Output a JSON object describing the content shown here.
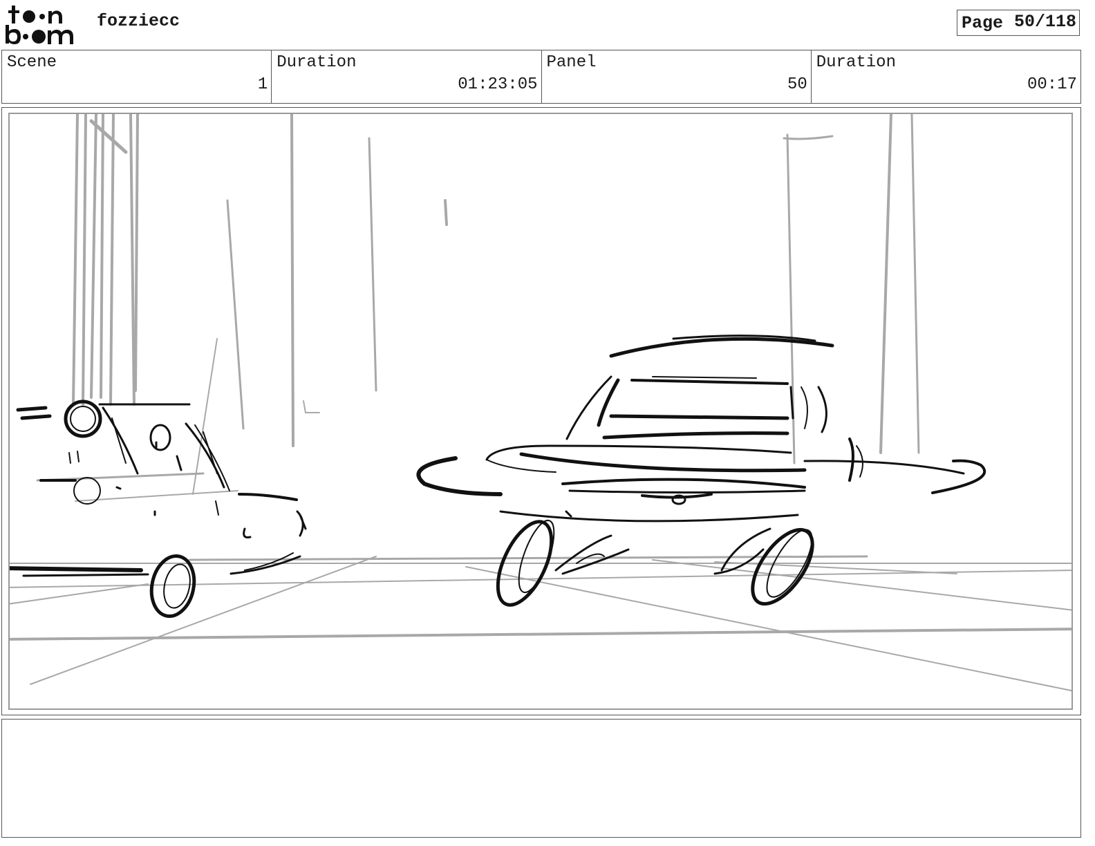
{
  "header": {
    "brand": "toon boom",
    "project_name": "fozziecc",
    "page_label": "Page",
    "page_value": "50/118"
  },
  "info": {
    "scene_label": "Scene",
    "scene_value": "1",
    "scene_duration_label": "Duration",
    "scene_duration_value": "01:23:05",
    "panel_label": "Panel",
    "panel_value": "50",
    "panel_duration_label": "Duration",
    "panel_duration_value": "00:17"
  },
  "notes": {
    "text": ""
  }
}
